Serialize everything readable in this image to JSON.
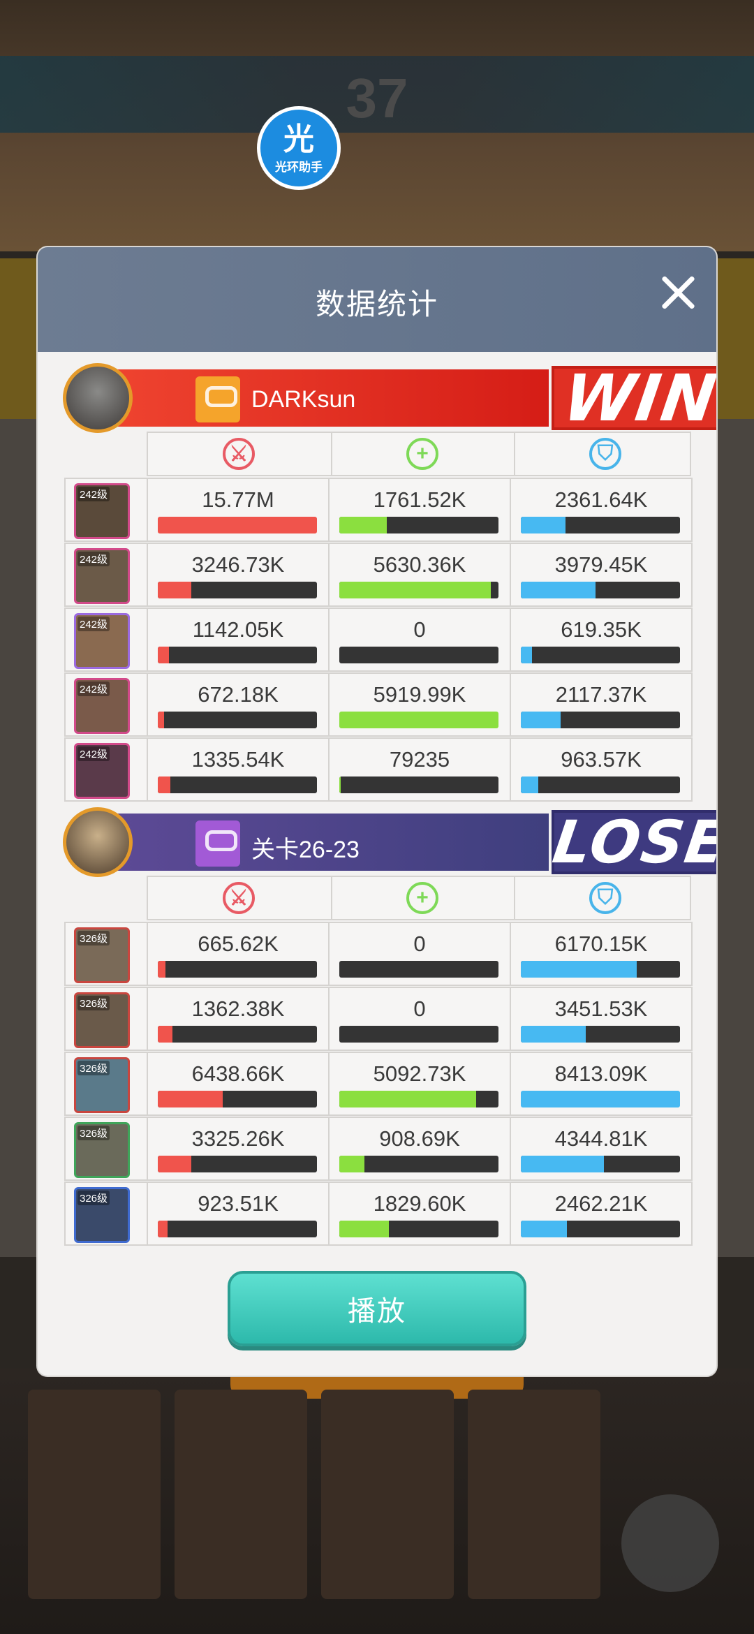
{
  "background": {
    "round_number": "37"
  },
  "watermark": {
    "main_char": "光",
    "sub_text": "光环助手"
  },
  "dialog": {
    "title": "数据统计",
    "play_button": "播放"
  },
  "teams": [
    {
      "name": "DARKsun",
      "result": "WIN",
      "heroes": [
        {
          "level": "242级",
          "damage": "15.77M",
          "damage_frac": 1.0,
          "heal": "1761.52K",
          "heal_frac": 0.3,
          "defense": "2361.64K",
          "defense_frac": 0.28
        },
        {
          "level": "242级",
          "damage": "3246.73K",
          "damage_frac": 0.21,
          "heal": "5630.36K",
          "heal_frac": 0.95,
          "defense": "3979.45K",
          "defense_frac": 0.47
        },
        {
          "level": "242级",
          "damage": "1142.05K",
          "damage_frac": 0.07,
          "heal": "0",
          "heal_frac": 0.0,
          "defense": "619.35K",
          "defense_frac": 0.07
        },
        {
          "level": "242级",
          "damage": "672.18K",
          "damage_frac": 0.04,
          "heal": "5919.99K",
          "heal_frac": 1.0,
          "defense": "2117.37K",
          "defense_frac": 0.25
        },
        {
          "level": "242级",
          "damage": "1335.54K",
          "damage_frac": 0.08,
          "heal": "79235",
          "heal_frac": 0.01,
          "defense": "963.57K",
          "defense_frac": 0.11
        }
      ]
    },
    {
      "name": "关卡26-23",
      "result": "LOSE",
      "heroes": [
        {
          "level": "326级",
          "damage": "665.62K",
          "damage_frac": 0.05,
          "heal": "0",
          "heal_frac": 0.0,
          "defense": "6170.15K",
          "defense_frac": 0.73
        },
        {
          "level": "326级",
          "damage": "1362.38K",
          "damage_frac": 0.09,
          "heal": "0",
          "heal_frac": 0.0,
          "defense": "3451.53K",
          "defense_frac": 0.41
        },
        {
          "level": "326级",
          "damage": "6438.66K",
          "damage_frac": 0.41,
          "heal": "5092.73K",
          "heal_frac": 0.86,
          "defense": "8413.09K",
          "defense_frac": 1.0
        },
        {
          "level": "326级",
          "damage": "3325.26K",
          "damage_frac": 0.21,
          "heal": "908.69K",
          "heal_frac": 0.16,
          "defense": "4344.81K",
          "defense_frac": 0.52
        },
        {
          "level": "326级",
          "damage": "923.51K",
          "damage_frac": 0.06,
          "heal": "1829.60K",
          "heal_frac": 0.31,
          "defense": "2462.21K",
          "defense_frac": 0.29
        }
      ]
    }
  ],
  "colors": {
    "damage": "#f0544c",
    "heal": "#8bdf3f",
    "defense": "#47b9f2",
    "win": "#e03024",
    "lose": "#3e3a80"
  },
  "icons": {
    "damage": "damage-icon",
    "heal": "heal-icon",
    "defense": "shield-icon",
    "close": "close-icon"
  }
}
